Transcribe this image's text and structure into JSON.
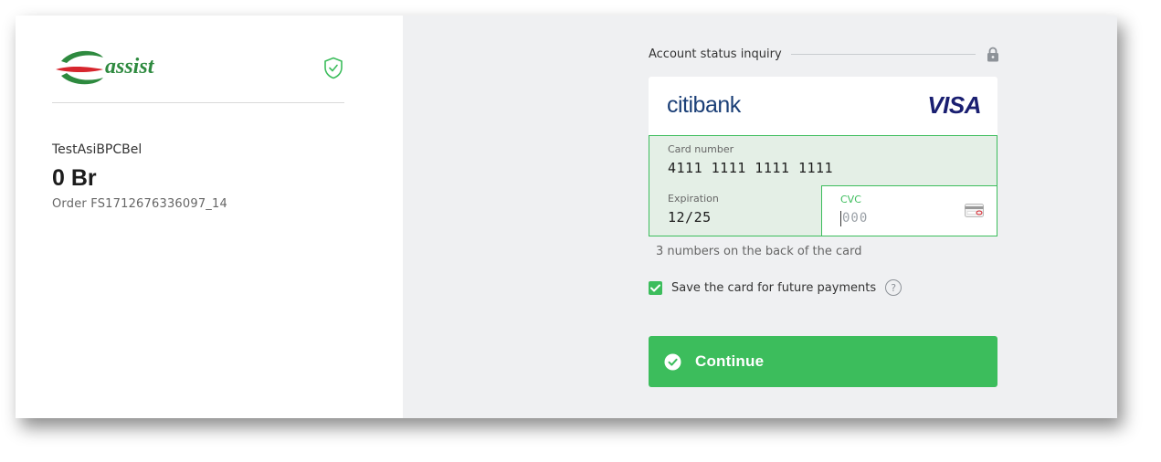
{
  "brand": {
    "logo_text": "assist",
    "accent": "#3cbd5c"
  },
  "summary": {
    "merchant": "TestAsiBPCBel",
    "amount": "0 Br",
    "order": "Order FS1712676336097_14"
  },
  "form": {
    "status_text": "Account status inquiry",
    "bank_name": "citibank",
    "card_brand": "VISA",
    "card_number": {
      "label": "Card number",
      "value": "4111 1111 1111 1111"
    },
    "expiration": {
      "label": "Expiration",
      "value": "12/25"
    },
    "cvc": {
      "label": "CVC",
      "placeholder": "000"
    },
    "cvc_hint": "3 numbers on the back of the card",
    "save_card": {
      "label": "Save the card for future payments",
      "checked": true,
      "help": "?"
    },
    "continue_label": "Continue"
  },
  "icons": [
    "shield-check-icon",
    "lock-icon",
    "card-back-icon",
    "check-icon",
    "help-icon",
    "check-circle-icon"
  ]
}
